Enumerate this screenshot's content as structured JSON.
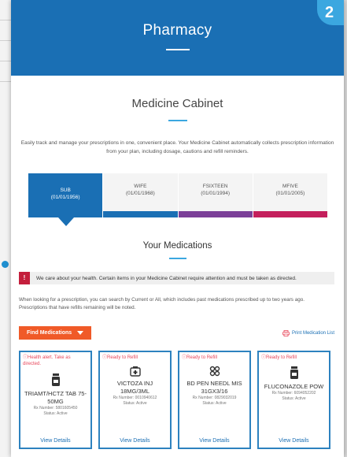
{
  "background": {
    "row_arrows": [
      ">",
      ">",
      ">",
      ">"
    ]
  },
  "step_badge": "2",
  "banner": {
    "title": "Pharmacy"
  },
  "medicine_cabinet": {
    "title": "Medicine Cabinet",
    "intro": "Easily track and manage your prescriptions in one, convenient place. Your Medicine Cabinet automatically collects prescription information from your plan, including dosage, cautions and refill reminders."
  },
  "members": [
    {
      "name": "SUB",
      "dob": "(01/01/1956)",
      "color": "#1a6fb4",
      "active": true
    },
    {
      "name": "WIFE",
      "dob": "(01/01/1968)",
      "color": "#1a6fb4",
      "active": false
    },
    {
      "name": "FSIXTEEN",
      "dob": "(01/01/1994)",
      "color": "#7b3f98",
      "active": false
    },
    {
      "name": "MFIVE",
      "dob": "(01/01/2005)",
      "color": "#c41f5c",
      "active": false
    }
  ],
  "your_medications": {
    "title": "Your Medications",
    "alert_icon": "!",
    "alert_text": "We care about your health. Certain items in your Medicine Cabinet require attention and must be taken as directed.",
    "search_help": "When looking for a prescription, you can search by Current or All, which includes past medications prescribed up to two years ago. Prescriptions that have refills remaining will be noted.",
    "find_button": "Find Medications",
    "print_link": "Print Medication List"
  },
  "medications": [
    {
      "status": "Health alert. Take as directed.",
      "icon": "pill-bottle-icon",
      "name": "TRIAMT/HCTZ TAB 75-50MG",
      "rx": "Rx Number: 5801605450",
      "state": "Status: Active",
      "link": "View Details"
    },
    {
      "status": "Ready to Refill",
      "icon": "injection-pen-icon",
      "name": "VICTOZA INJ 18MG/3ML",
      "rx": "Rx Number: 0010940612",
      "state": "Status: Active",
      "link": "View Details"
    },
    {
      "status": "Ready to Refill",
      "icon": "needle-icon",
      "name": "BD PEN NEEDL MIS 31GX3/16",
      "rx": "Rx Number: 0829032019",
      "state": "Status: Active",
      "link": "View Details"
    },
    {
      "status": "Ready to Refill",
      "icon": "pill-bottle-icon",
      "name": "FLUCONAZOLE POW",
      "rx": "Rx Number: 6094052202",
      "state": "Status: Active",
      "link": "View Details"
    }
  ]
}
